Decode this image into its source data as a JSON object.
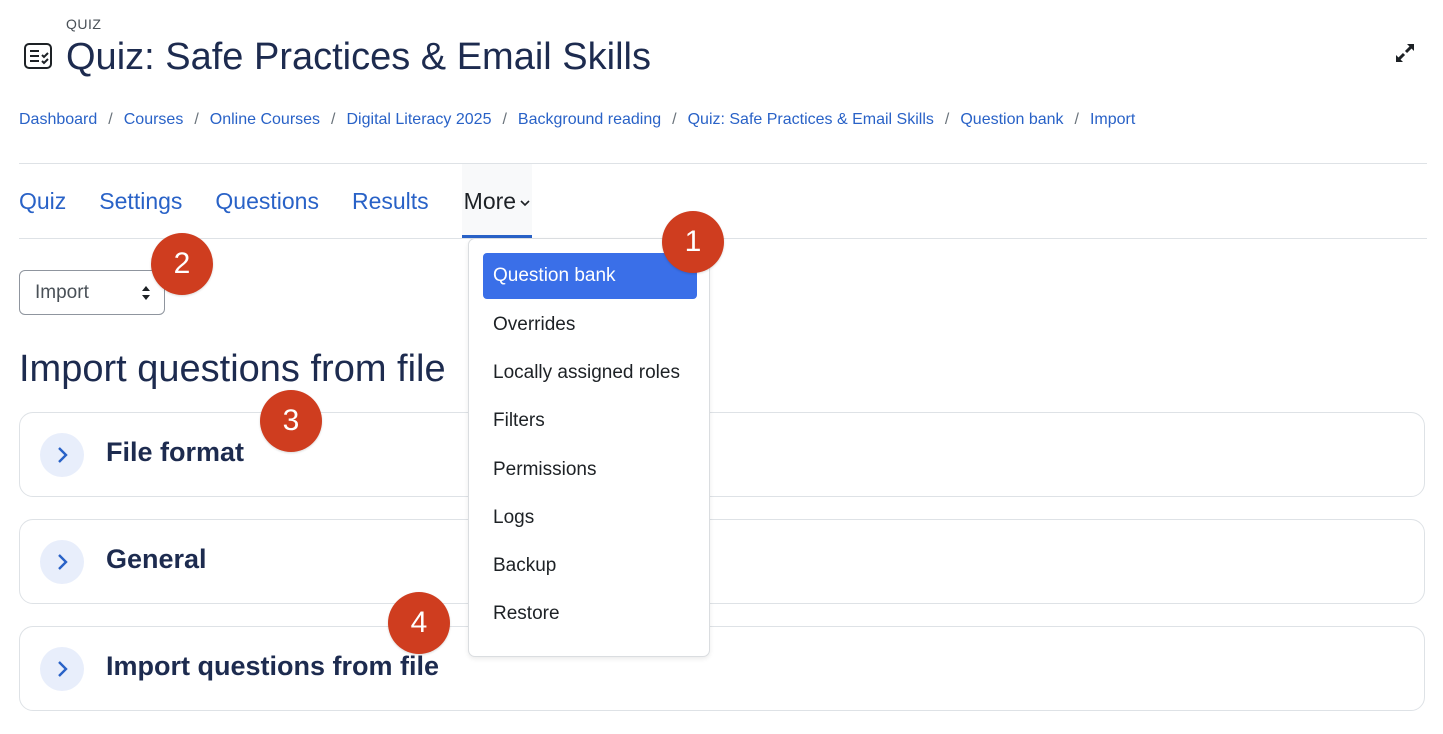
{
  "header": {
    "module_type": "QUIZ",
    "title": "Quiz: Safe Practices & Email Skills",
    "module_icon": "quiz-icon",
    "expand_icon": "expand-icon"
  },
  "breadcrumb": [
    "Dashboard",
    "Courses",
    "Online Courses",
    "Digital Literacy 2025",
    "Background reading",
    "Quiz: Safe Practices & Email Skills",
    "Question bank",
    "Import"
  ],
  "breadcrumb_separator": "/",
  "tabs": [
    "Quiz",
    "Settings",
    "Questions",
    "Results",
    "More"
  ],
  "active_tab": "More",
  "select": {
    "value": "Import"
  },
  "main": {
    "heading": "Import questions from file",
    "panels": [
      "File format",
      "General",
      "Import questions from file"
    ]
  },
  "more_menu": {
    "items": [
      "Question bank",
      "Overrides",
      "Locally assigned roles",
      "Filters",
      "Permissions",
      "Logs",
      "Backup",
      "Restore"
    ],
    "active": "Question bank"
  },
  "callouts": [
    "1",
    "2",
    "3",
    "4"
  ],
  "colors": {
    "link": "#2962c7",
    "title": "#1d2b4f",
    "active_item": "#3a6fe8",
    "callout": "#cf3d1f"
  }
}
